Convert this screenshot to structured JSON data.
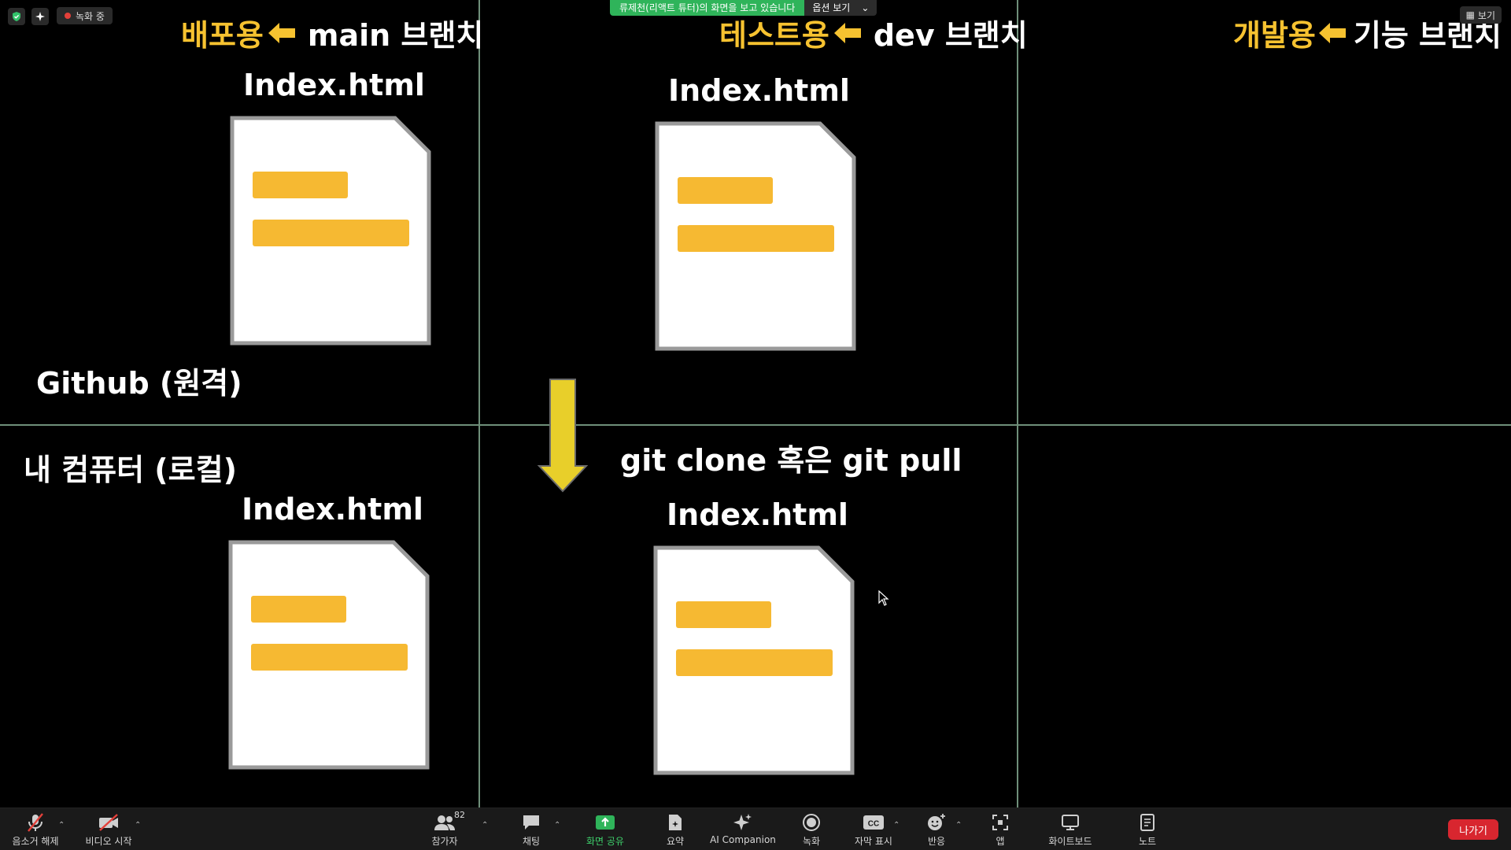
{
  "status": {
    "recording_label": "녹화 중"
  },
  "banner": {
    "message": "류제천(리액트 튜터)의 화면을 보고 있습니다",
    "options_label": "옵션 보기",
    "view_label": "보기"
  },
  "slide": {
    "columns": [
      {
        "kind": "배포용",
        "branch": "main 브랜치"
      },
      {
        "kind": "테스트용",
        "branch": "dev 브랜치"
      },
      {
        "kind": "개발용",
        "branch": "기능 브랜치"
      }
    ],
    "files": {
      "remote_main": "Index.html",
      "remote_dev": "Index.html",
      "local_main": "Index.html",
      "local_dev": "Index.html"
    },
    "remote_label": "Github (원격)",
    "local_label": "내 컴퓨터 (로컬)",
    "git_command": "git clone 혹은 git pull",
    "colors": {
      "accent_yellow": "#f6c230",
      "arrow_yellow": "#e8cf2a",
      "divider": "#6f8f7a"
    }
  },
  "toolbar": {
    "mute": "음소거 해제",
    "video": "비디오 시작",
    "participants": "참가자",
    "participant_count": "82",
    "chat": "채팅",
    "share": "화면 공유",
    "summary": "요약",
    "ai": "AI Companion",
    "record": "녹화",
    "captions": "자막 표시",
    "captions_icon": "CC",
    "reactions": "반응",
    "apps": "앱",
    "whiteboard": "화이트보드",
    "notes": "노트",
    "leave": "나가기"
  }
}
